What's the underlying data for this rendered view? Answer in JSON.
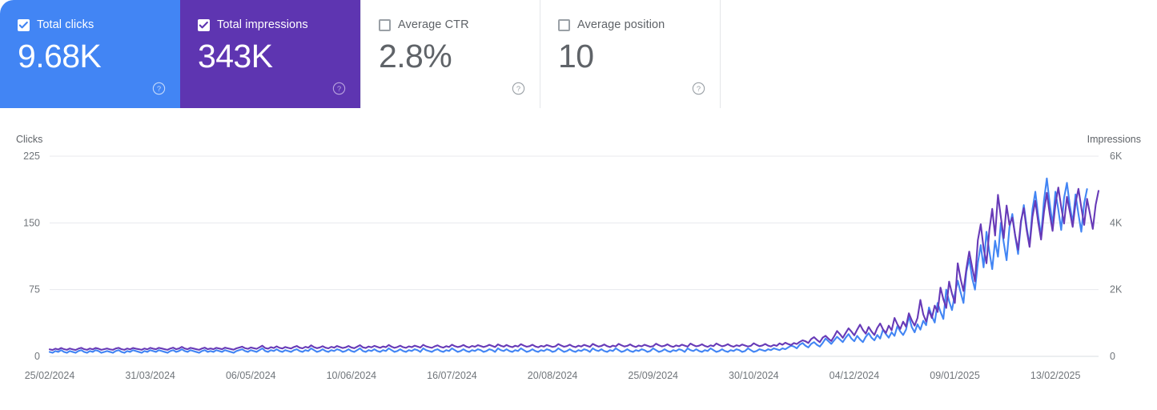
{
  "metrics": [
    {
      "label": "Total clicks",
      "value": "9.68K",
      "checked": true,
      "color": "#4285f4",
      "help": "help-icon"
    },
    {
      "label": "Total impressions",
      "value": "343K",
      "checked": true,
      "color": "#5e35b1",
      "help": "help-icon"
    },
    {
      "label": "Average CTR",
      "value": "2.8%",
      "checked": false,
      "color": "#ffffff",
      "help": "help-icon"
    },
    {
      "label": "Average position",
      "value": "10",
      "checked": false,
      "color": "#ffffff",
      "help": "help-icon"
    }
  ],
  "chart_data": {
    "type": "line",
    "title": "",
    "xlabel": "",
    "left_axis_name": "Clicks",
    "right_axis_name": "Impressions",
    "left_ticks": [
      "0",
      "75",
      "150",
      "225"
    ],
    "left_values": [
      0,
      75,
      150,
      225
    ],
    "right_ticks": [
      "0",
      "2K",
      "4K",
      "6K"
    ],
    "right_values": [
      0,
      2000,
      4000,
      6000
    ],
    "ylim_left": [
      0,
      225
    ],
    "ylim_right": [
      0,
      6000
    ],
    "grid": true,
    "legend_position": "none",
    "x_tick_labels": [
      "25/02/2024",
      "31/03/2024",
      "06/05/2024",
      "10/06/2024",
      "16/07/2024",
      "20/08/2024",
      "25/09/2024",
      "30/10/2024",
      "04/12/2024",
      "09/01/2025",
      "13/02/2025"
    ],
    "x_tick_indices": [
      0,
      35,
      70,
      105,
      140,
      175,
      210,
      245,
      280,
      315,
      350
    ],
    "n_points": 366,
    "series": [
      {
        "name": "Clicks",
        "color": "#4285f4",
        "axis": "left",
        "values": [
          5,
          4,
          6,
          5,
          7,
          5,
          4,
          6,
          5,
          4,
          6,
          7,
          5,
          4,
          6,
          5,
          7,
          6,
          4,
          5,
          6,
          5,
          4,
          6,
          7,
          5,
          4,
          6,
          5,
          7,
          6,
          5,
          4,
          6,
          5,
          7,
          6,
          5,
          7,
          6,
          5,
          4,
          6,
          7,
          5,
          6,
          8,
          6,
          5,
          7,
          6,
          5,
          4,
          6,
          7,
          5,
          6,
          5,
          7,
          6,
          5,
          7,
          6,
          5,
          4,
          6,
          7,
          8,
          6,
          5,
          7,
          6,
          5,
          7,
          9,
          6,
          5,
          7,
          6,
          8,
          6,
          5,
          7,
          6,
          5,
          7,
          8,
          6,
          5,
          7,
          6,
          9,
          7,
          5,
          6,
          8,
          6,
          5,
          7,
          6,
          8,
          7,
          5,
          6,
          8,
          6,
          5,
          7,
          9,
          6,
          5,
          7,
          6,
          8,
          6,
          5,
          7,
          6,
          9,
          7,
          5,
          6,
          8,
          6,
          5,
          7,
          6,
          8,
          7,
          5,
          9,
          7,
          6,
          5,
          7,
          8,
          6,
          5,
          7,
          6,
          9,
          7,
          5,
          6,
          8,
          6,
          5,
          7,
          6,
          8,
          7,
          5,
          6,
          8,
          7,
          5,
          9,
          7,
          6,
          8,
          6,
          5,
          7,
          6,
          9,
          7,
          5,
          6,
          8,
          6,
          5,
          7,
          6,
          8,
          7,
          5,
          6,
          9,
          7,
          5,
          6,
          8,
          6,
          5,
          7,
          6,
          8,
          7,
          5,
          9,
          7,
          6,
          8,
          6,
          5,
          7,
          6,
          9,
          7,
          5,
          6,
          8,
          6,
          5,
          7,
          6,
          8,
          7,
          5,
          6,
          9,
          7,
          5,
          6,
          8,
          6,
          5,
          7,
          6,
          8,
          7,
          5,
          9,
          7,
          6,
          8,
          6,
          5,
          7,
          6,
          9,
          7,
          5,
          6,
          8,
          6,
          5,
          7,
          6,
          8,
          7,
          5,
          6,
          9,
          7,
          5,
          6,
          8,
          7,
          6,
          8,
          7,
          9,
          8,
          7,
          9,
          8,
          10,
          12,
          11,
          9,
          13,
          15,
          12,
          10,
          14,
          16,
          13,
          11,
          15,
          20,
          17,
          14,
          18,
          22,
          19,
          16,
          21,
          25,
          20,
          17,
          23,
          19,
          16,
          22,
          26,
          21,
          18,
          24,
          20,
          30,
          25,
          21,
          27,
          23,
          34,
          28,
          24,
          30,
          45,
          33,
          27,
          36,
          30,
          40,
          35,
          55,
          45,
          38,
          60,
          50,
          42,
          75,
          62,
          52,
          70,
          85,
          72,
          60,
          95,
          110,
          88,
          75,
          105,
          125,
          100,
          140,
          118,
          98,
          130,
          112,
          150,
          128,
          108,
          145,
          160,
          135,
          115,
          150,
          170,
          145,
          125,
          165,
          185,
          158,
          135,
          175,
          200,
          172,
          148,
          185,
          165,
          142,
          178,
          195,
          170,
          150,
          182,
          160,
          140,
          172,
          188
        ]
      },
      {
        "name": "Impressions",
        "color": "#673ab7",
        "axis": "right",
        "values": [
          210,
          190,
          230,
          205,
          250,
          215,
          195,
          235,
          210,
          190,
          230,
          255,
          215,
          195,
          235,
          210,
          250,
          230,
          195,
          215,
          235,
          210,
          195,
          235,
          255,
          215,
          195,
          235,
          210,
          250,
          230,
          215,
          195,
          235,
          210,
          255,
          230,
          215,
          255,
          235,
          215,
          195,
          235,
          260,
          215,
          235,
          285,
          235,
          215,
          255,
          235,
          215,
          195,
          235,
          260,
          215,
          235,
          215,
          255,
          235,
          215,
          260,
          240,
          220,
          200,
          240,
          265,
          290,
          245,
          225,
          265,
          245,
          225,
          270,
          320,
          250,
          230,
          275,
          250,
          300,
          255,
          235,
          280,
          255,
          235,
          280,
          310,
          260,
          240,
          285,
          260,
          330,
          275,
          245,
          265,
          305,
          260,
          240,
          285,
          260,
          310,
          280,
          250,
          270,
          310,
          265,
          245,
          290,
          335,
          270,
          250,
          295,
          270,
          315,
          285,
          255,
          295,
          275,
          340,
          290,
          255,
          280,
          320,
          275,
          255,
          300,
          275,
          320,
          295,
          265,
          345,
          300,
          275,
          255,
          300,
          330,
          285,
          262,
          305,
          280,
          350,
          305,
          278,
          298,
          340,
          292,
          268,
          312,
          288,
          335,
          308,
          278,
          305,
          345,
          312,
          280,
          358,
          318,
          290,
          340,
          300,
          275,
          318,
          295,
          365,
          322,
          288,
          305,
          348,
          298,
          272,
          315,
          292,
          340,
          312,
          282,
          300,
          368,
          325,
          288,
          308,
          350,
          300,
          275,
          320,
          295,
          345,
          315,
          285,
          372,
          330,
          292,
          312,
          355,
          305,
          278,
          322,
          298,
          375,
          332,
          295,
          315,
          358,
          308,
          280,
          325,
          300,
          348,
          318,
          288,
          305,
          378,
          335,
          298,
          318,
          360,
          310,
          282,
          328,
          302,
          350,
          320,
          290,
          382,
          338,
          300,
          320,
          362,
          312,
          285,
          330,
          305,
          385,
          340,
          302,
          322,
          365,
          315,
          288,
          332,
          308,
          355,
          325,
          295,
          315,
          392,
          345,
          305,
          325,
          370,
          322,
          298,
          342,
          315,
          388,
          348,
          408,
          368,
          338,
          398,
          370,
          432,
          480,
          452,
          400,
          520,
          575,
          495,
          425,
          560,
          615,
          530,
          460,
          600,
          760,
          665,
          555,
          700,
          840,
          745,
          630,
          800,
          950,
          790,
          680,
          880,
          745,
          640,
          850,
          985,
          810,
          700,
          920,
          780,
          1150,
          960,
          820,
          1040,
          890,
          1290,
          1080,
          920,
          1150,
          1690,
          1260,
          1040,
          1375,
          1150,
          1520,
          1330,
          2060,
          1710,
          1450,
          2240,
          1880,
          1600,
          2790,
          2320,
          1960,
          2620,
          3140,
          2680,
          2250,
          3480,
          3960,
          3240,
          2790,
          3780,
          4420,
          3620,
          4840,
          4180,
          3540,
          4520,
          3940,
          4160,
          3620,
          3200,
          4060,
          4440,
          3780,
          3280,
          4180,
          4660,
          4020,
          3500,
          4320,
          4900,
          4280,
          3760,
          4560,
          5060,
          4480,
          3980,
          4780,
          4340,
          3880,
          4600,
          5020,
          4460,
          3940,
          4720,
          4280,
          3820,
          4540,
          4960
        ]
      }
    ]
  }
}
